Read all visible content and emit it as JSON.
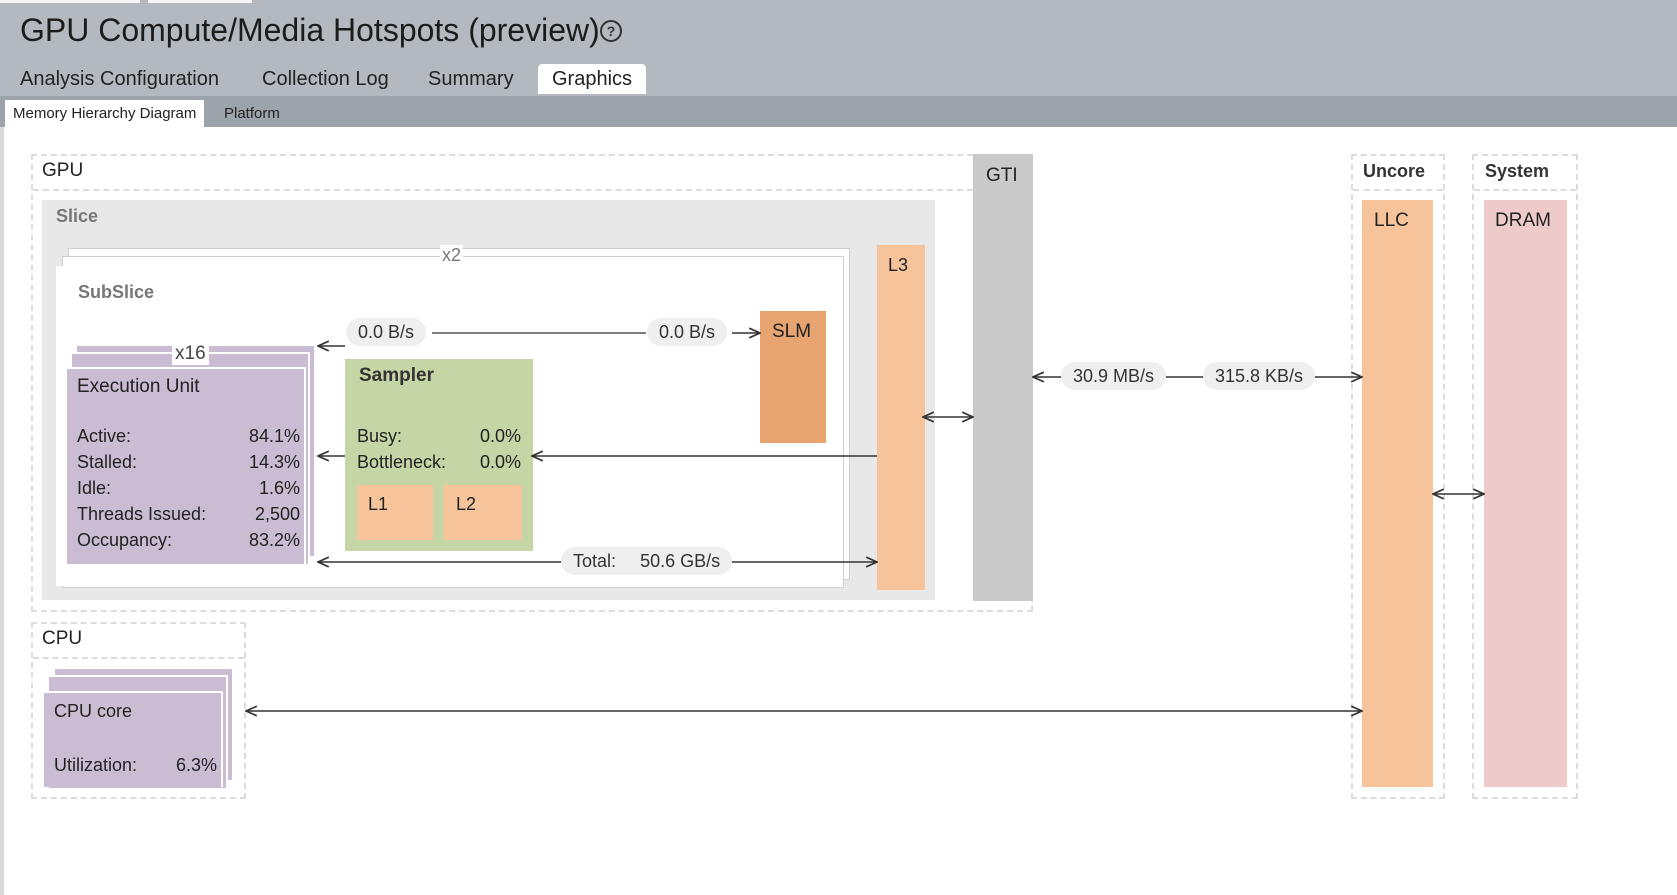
{
  "header": {
    "title": "GPU Compute/Media Hotspots (preview)",
    "help_icon": "?"
  },
  "main_tabs": [
    {
      "label": "Analysis Configuration",
      "active": false
    },
    {
      "label": "Collection Log",
      "active": false
    },
    {
      "label": "Summary",
      "active": false
    },
    {
      "label": "Graphics",
      "active": true
    }
  ],
  "sub_tabs": [
    {
      "label": "Memory Hierarchy Diagram",
      "active": true
    },
    {
      "label": "Platform",
      "active": false
    }
  ],
  "diagram": {
    "gpu": {
      "label": "GPU",
      "slice_label": "Slice",
      "slice_multiplier": "x2",
      "subslice_label": "SubSlice",
      "eu_multiplier": "x16",
      "eu": {
        "title": "Execution Unit",
        "stats": [
          {
            "label": "Active:",
            "value": "84.1%"
          },
          {
            "label": "Stalled:",
            "value": "14.3%"
          },
          {
            "label": "Idle:",
            "value": "1.6%"
          },
          {
            "label": "Threads Issued:",
            "value": "2,500"
          },
          {
            "label": "Occupancy:",
            "value": "83.2%"
          }
        ]
      },
      "sampler": {
        "title": "Sampler",
        "stats": [
          {
            "label": "Busy:",
            "value": "0.0%"
          },
          {
            "label": "Bottleneck:",
            "value": "0.0%"
          }
        ],
        "l1": "L1",
        "l2": "L2"
      },
      "slm": "SLM",
      "slm_read": "0.0 B/s",
      "slm_write": "0.0 B/s",
      "l3": "L3",
      "total_label": "Total:",
      "total_value": "50.6 GB/s",
      "gti": "GTI"
    },
    "gti_read": "30.9 MB/s",
    "gti_write": "315.8 KB/s",
    "uncore": {
      "label": "Uncore",
      "llc": "LLC"
    },
    "system": {
      "label": "System",
      "dram": "DRAM"
    },
    "cpu": {
      "label": "CPU",
      "core_title": "CPU core",
      "util_label": "Utilization:",
      "util_value": "6.3%"
    }
  },
  "colors": {
    "header_bg": "#b4b9bf",
    "subbar_bg": "#9da3aa",
    "eu": "#c9bcd3",
    "sampler": "#c5d5a5",
    "cache": "#f7c39a",
    "slm": "#e7a471",
    "gti": "#c9c9c9",
    "dram": "#efcaca",
    "slice_bg": "#e8e8e8"
  }
}
